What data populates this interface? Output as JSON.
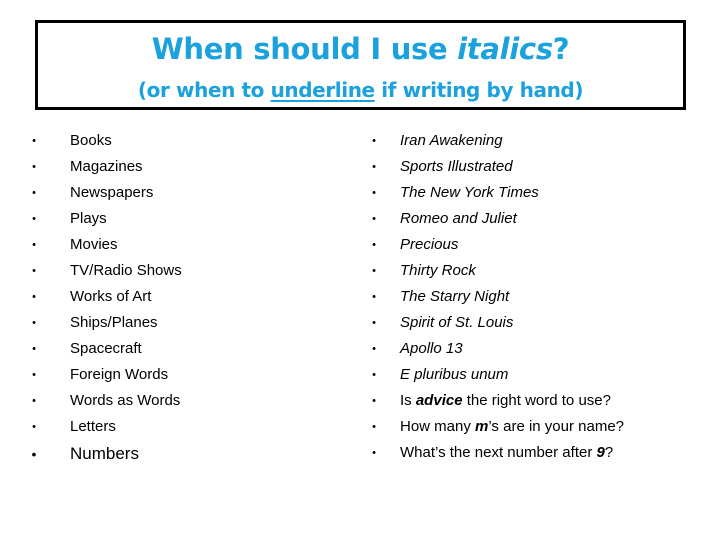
{
  "header": {
    "title_prefix": "When should I use ",
    "title_emphasis": "italics",
    "title_suffix": "?",
    "subtitle_prefix": "(or when to ",
    "subtitle_emphasis": "underline",
    "subtitle_suffix": " if writing by hand)",
    "accent_color": "#1ba1dc"
  },
  "left_list": {
    "bullet": "•",
    "items": [
      "Books",
      "Magazines",
      "Newspapers",
      "Plays",
      "Movies",
      "TV/Radio Shows",
      "Works of Art",
      "Ships/Planes",
      "Spacecraft",
      "Foreign Words",
      "Words as Words",
      "Letters",
      "Numbers"
    ]
  },
  "right_list": {
    "bullet": "•",
    "italic_items": [
      "Iran Awakening",
      "Sports Illustrated",
      "The New York Times",
      "Romeo and Juliet",
      "Precious",
      "Thirty Rock",
      "The Starry Night",
      "Spirit of St. Louis",
      "Apollo 13",
      "E pluribus unum"
    ],
    "examples": [
      {
        "before": "Is ",
        "emphasis": "advice",
        "after": " the right word to use?"
      },
      {
        "before": "How many ",
        "emphasis": "m",
        "after": "’s are in your name?"
      },
      {
        "before": "What’s the next number after ",
        "emphasis": "9",
        "after": "?"
      }
    ]
  }
}
